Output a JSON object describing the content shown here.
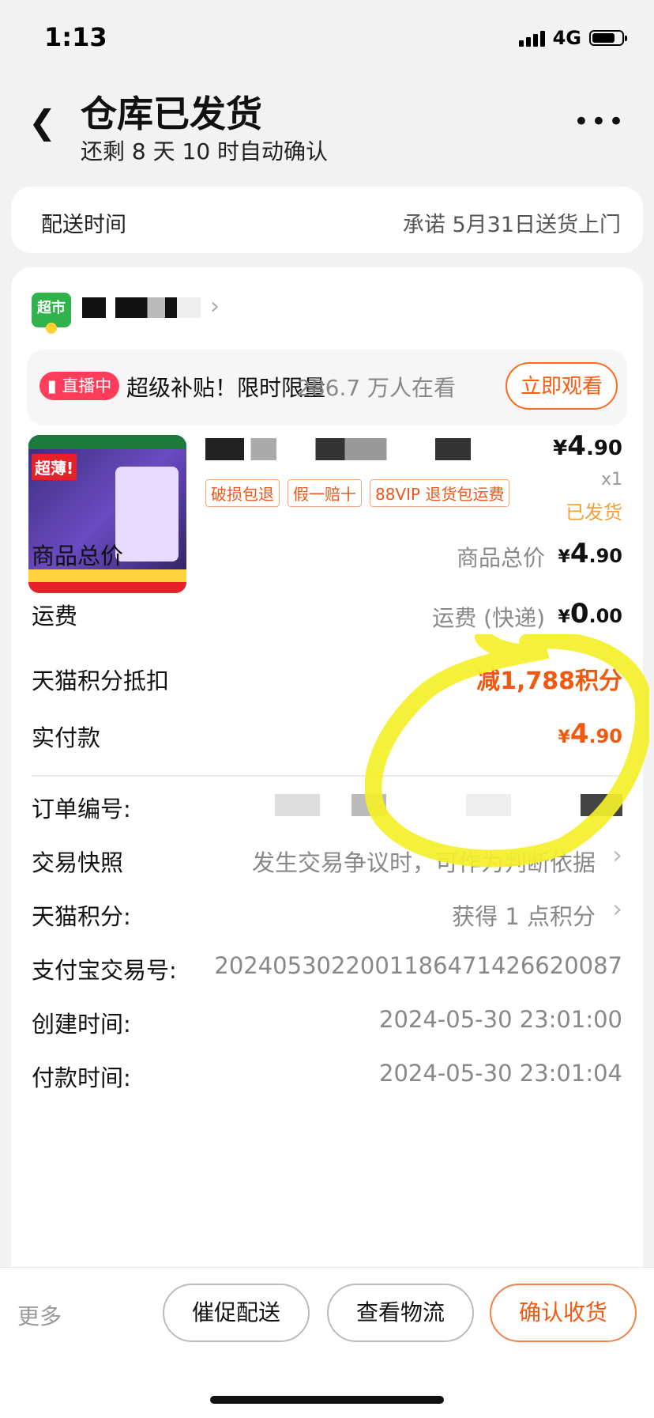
{
  "status": {
    "time": "1:13",
    "network": "4G"
  },
  "header": {
    "title": "仓库已发货",
    "subtitle": "还剩 8 天 10 时自动确认"
  },
  "delivery": {
    "label": "配送时间",
    "value": "承诺 5月31日送货上门"
  },
  "shop": {
    "logo_text": "超市"
  },
  "live": {
    "badge": "直播中",
    "text": "超级补贴！限时限量",
    "viewers": "286.7 万人在看",
    "button": "立即观看"
  },
  "product": {
    "image_badge": "超薄!",
    "price_currency": "¥",
    "price_int": "4",
    "price_dec": ".90",
    "quantity": "x1",
    "status": "已发货",
    "tags": [
      "破损包退",
      "假一赔十",
      "88VIP 退货包运费"
    ]
  },
  "summary": {
    "goods_total_label": "商品总价",
    "goods_total_sub": "商品总价",
    "goods_total_int": "4",
    "goods_total_dec": ".90",
    "shipping_label": "运费",
    "shipping_sub": "运费 (快递)",
    "shipping_int": "0",
    "shipping_dec": ".00",
    "points_label": "天猫积分抵扣",
    "points_value": "减1,788积分",
    "paid_label": "实付款",
    "paid_int": "4",
    "paid_dec": ".90",
    "currency": "¥"
  },
  "info": {
    "order_no_label": "订单编号:",
    "snapshot_label": "交易快照",
    "snapshot_value": "发生交易争议时，可作为判断依据",
    "points_label": "天猫积分:",
    "points_value": "获得 1 点积分",
    "alipay_label": "支付宝交易号:",
    "alipay_value": "2024053022001186471426620087",
    "created_label": "创建时间:",
    "created_value": "2024-05-30 23:01:00",
    "paid_label": "付款时间:",
    "paid_value": "2024-05-30 23:01:04"
  },
  "actions": {
    "more": "更多",
    "urge": "催促配送",
    "logistics": "查看物流",
    "confirm": "确认收货"
  },
  "colors": {
    "accent": "#f05a10",
    "highlight": "#f4f02a",
    "brand_green": "#2fb34a"
  }
}
